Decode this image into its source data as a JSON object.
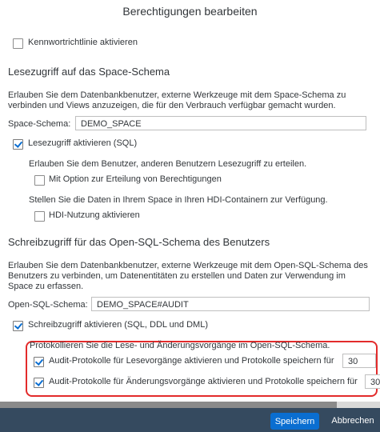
{
  "dialog": {
    "title": "Berechtigungen bearbeiten"
  },
  "password_policy": {
    "label": "Kennwortrichtlinie aktivieren",
    "checked": false
  },
  "read_section": {
    "title": "Lesezugriff auf das Space-Schema",
    "desc_line1": "Erlauben Sie dem Datenbankbenutzer, externe Werkzeuge mit dem Space-Schema zu",
    "desc_line2": "verbinden und Views anzuzeigen, die für den Verbrauch verfügbar gemacht wurden.",
    "schema_label": "Space-Schema:",
    "schema_value": "DEMO_SPACE",
    "enable_label": "Lesezugriff aktivieren (SQL)",
    "enable_checked": true,
    "grant_desc": "Erlauben Sie dem Benutzer, anderen Benutzern Lesezugriff zu erteilen.",
    "grant_label": "Mit Option zur Erteilung von Berechtigungen",
    "grant_checked": false,
    "hdi_desc": "Stellen Sie die Daten in Ihrem Space in Ihren HDI-Containern zur Verfügung.",
    "hdi_label": "HDI-Nutzung aktivieren",
    "hdi_checked": false
  },
  "write_section": {
    "title": "Schreibzugriff für das Open-SQL-Schema des Benutzers",
    "desc_line1": "Erlauben Sie dem Datenbankbenutzer, externe Werkzeuge mit dem Open-SQL-Schema des",
    "desc_line2": "Benutzers zu verbinden, um Datenentitäten zu erstellen und Daten zur Verwendung im",
    "desc_line3": "Space zu erfassen.",
    "schema_label": "Open-SQL-Schema:",
    "schema_value": "DEMO_SPACE#AUDIT",
    "enable_label": "Schreibzugriff aktivieren (SQL, DDL und DML)",
    "enable_checked": true,
    "audit_desc": "Protokollieren Sie die Lese- und Änderungsvorgänge im Open-SQL-Schema.",
    "audit_read_label": "Audit-Protokolle für Lesevorgänge aktivieren und Protokolle speichern für",
    "audit_read_checked": true,
    "audit_read_days": "30",
    "audit_change_label": "Audit-Protokolle für Änderungsvorgänge aktivieren und Protokolle speichern für",
    "audit_change_checked": true,
    "audit_change_days": "30"
  },
  "footer": {
    "save_label": "Speichern",
    "cancel_label": "Abbrechen"
  },
  "colors": {
    "accent": "#0a6ed1",
    "footer_bg": "#354a5f",
    "highlight": "#e32b2b"
  }
}
